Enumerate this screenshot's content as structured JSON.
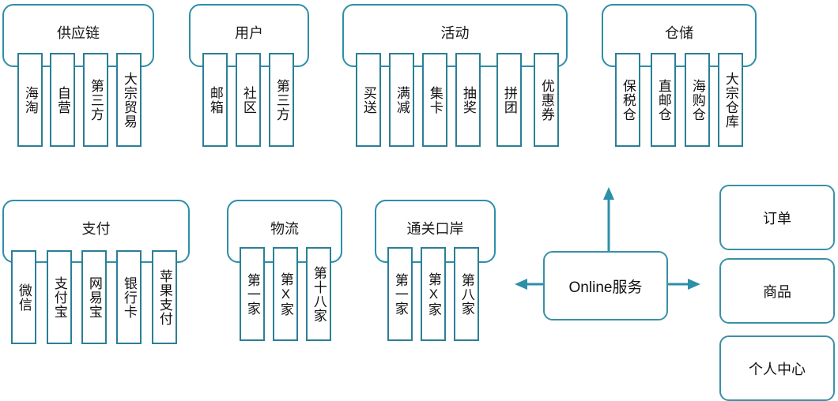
{
  "diagram": {
    "title_row1": "",
    "groups": [
      {
        "id": "supply-chain",
        "title": "供应链",
        "items": [
          "海淘",
          "自营",
          "第三方",
          "大宗贸易"
        ]
      },
      {
        "id": "user",
        "title": "用户",
        "items": [
          "邮箱",
          "社区",
          "第三方"
        ]
      },
      {
        "id": "activity",
        "title": "活动",
        "items": [
          "买送",
          "满减",
          "集卡",
          "抽奖",
          "拼团",
          "优惠券"
        ]
      },
      {
        "id": "warehouse",
        "title": "仓储",
        "items": [
          "保税仓",
          "直邮仓",
          "海购仓",
          "大宗仓库"
        ]
      },
      {
        "id": "payment",
        "title": "支付",
        "items": [
          "微信",
          "支付宝",
          "网易宝",
          "银行卡",
          "苹果支付"
        ]
      },
      {
        "id": "logistics",
        "title": "物流",
        "items": [
          "第一家",
          "第X家",
          "第十八家"
        ]
      },
      {
        "id": "customs",
        "title": "通关口岸",
        "items": [
          "第一家",
          "第X家",
          "第八家"
        ]
      }
    ],
    "center_node": {
      "label": "Online服务"
    },
    "right_nodes": [
      {
        "label": "订单"
      },
      {
        "label": "商品"
      },
      {
        "label": "个人中心"
      }
    ],
    "arrows": [
      {
        "name": "arrow-up",
        "direction": "up"
      },
      {
        "name": "arrow-left",
        "direction": "left"
      },
      {
        "name": "arrow-right",
        "direction": "right"
      }
    ],
    "colors": {
      "container_stroke": "#2e8fa8",
      "leaf_stroke": "#2b7f96",
      "node_stroke": "#3a90a6",
      "arrow": "#2e8fa8",
      "text": "#111111",
      "background": "#ffffff"
    }
  }
}
